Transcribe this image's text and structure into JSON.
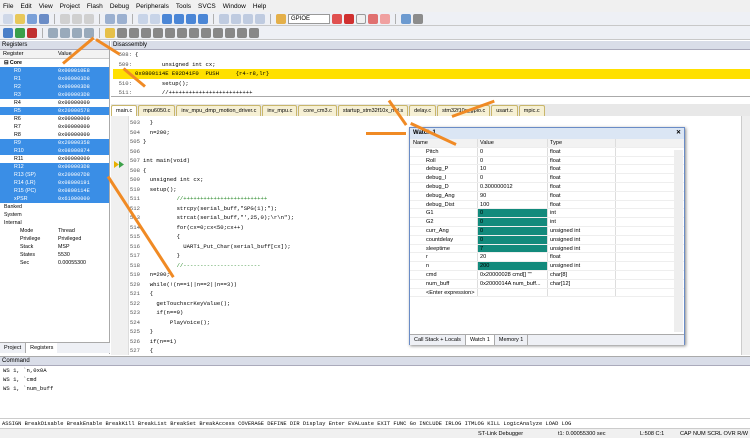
{
  "menu": [
    "File",
    "Edit",
    "View",
    "Project",
    "Flash",
    "Debug",
    "Peripherals",
    "Tools",
    "SVCS",
    "Window",
    "Help"
  ],
  "toolbar": {
    "target_combo": "GPIOE"
  },
  "registers": {
    "title": "Registers",
    "col_register": "Register",
    "col_value": "Value",
    "group_core": "Core",
    "rows": [
      {
        "n": "R0",
        "v": "0x000010E8",
        "h": true
      },
      {
        "n": "R1",
        "v": "0x000003D8",
        "h": true
      },
      {
        "n": "R2",
        "v": "0x000003D8",
        "h": true
      },
      {
        "n": "R3",
        "v": "0x000003D8",
        "h": true
      },
      {
        "n": "R4",
        "v": "0x00000000",
        "h": false
      },
      {
        "n": "R5",
        "v": "0x20000578",
        "h": true
      },
      {
        "n": "R6",
        "v": "0x00000000",
        "h": false
      },
      {
        "n": "R7",
        "v": "0x00000000",
        "h": false
      },
      {
        "n": "R8",
        "v": "0x00000000",
        "h": false
      },
      {
        "n": "R9",
        "v": "0x20000358",
        "h": true
      },
      {
        "n": "R10",
        "v": "0x08000874",
        "h": true
      },
      {
        "n": "R11",
        "v": "0x00000000",
        "h": false
      },
      {
        "n": "R12",
        "v": "0x000003D8",
        "h": true
      },
      {
        "n": "R13 (SP)",
        "v": "0x200007D8",
        "h": true
      },
      {
        "n": "R14 (LR)",
        "v": "0x08000191",
        "h": true
      },
      {
        "n": "R15 (PC)",
        "v": "0x0800114E",
        "h": true
      },
      {
        "n": "xPSR",
        "v": "0x61000000",
        "h": true
      }
    ],
    "groups": [
      "Banked",
      "System",
      "Internal"
    ],
    "internal": [
      {
        "n": "Mode",
        "v": "Thread"
      },
      {
        "n": "Privilege",
        "v": "Privileged"
      },
      {
        "n": "Stack",
        "v": "MSP"
      },
      {
        "n": "States",
        "v": "5530"
      },
      {
        "n": "Sec",
        "v": "0.00055300"
      }
    ],
    "tab_project": "Project",
    "tab_registers": "Registers"
  },
  "disassembly": {
    "title": "Disassembly",
    "lines": [
      {
        "ln": "508:",
        "t": "{"
      },
      {
        "ln": "509:",
        "t": "        unsigned int cx;"
      },
      {
        "ln": "",
        "t": "0x0800114E E92D41F0  PUSH     {r4-r8,lr}",
        "cur": true
      },
      {
        "ln": "510:",
        "t": "        setup();"
      },
      {
        "ln": "511:",
        "t": "        //+++++++++++++++++++++++++"
      }
    ]
  },
  "editor": {
    "tabs": [
      "main.c",
      "mpu6050.c",
      "inv_mpu_dmp_motion_driver.c",
      "inv_mpu.c",
      "core_cm3.c",
      "startup_stm32f10x_md.s",
      "delay.c",
      "stm32f10x_gpio.c",
      "usart.c",
      "mpic.c"
    ],
    "lines": [
      {
        "ln": "503",
        "t": "  }"
      },
      {
        "ln": "504",
        "t": "  n=200;"
      },
      {
        "ln": "505",
        "t": "}"
      },
      {
        "ln": "506",
        "t": ""
      },
      {
        "ln": "507",
        "t": "int main(void)"
      },
      {
        "ln": "508",
        "t": "{"
      },
      {
        "ln": "509",
        "t": "  unsigned int cx;"
      },
      {
        "ln": "510",
        "t": "  setup();"
      },
      {
        "ln": "511",
        "t": "          //+++++++++++++++++++++++++"
      },
      {
        "ln": "512",
        "t": "          strcpy(serial_buff,\"SPG(1);\");"
      },
      {
        "ln": "513",
        "t": "          strcat(serial_buff,\"',25,0);\\r\\n\");"
      },
      {
        "ln": "514",
        "t": "          for(cx=0;cx<50;cx++)"
      },
      {
        "ln": "515",
        "t": "          {"
      },
      {
        "ln": "516",
        "t": "            UART1_Put_Char(serial_buff[cx]);"
      },
      {
        "ln": "517",
        "t": "          }"
      },
      {
        "ln": "518",
        "t": "          //-----------------------"
      },
      {
        "ln": "519",
        "t": "  n=200;"
      },
      {
        "ln": "520",
        "t": "  while(!(n==1||n==2||n==3))"
      },
      {
        "ln": "521",
        "t": "  {"
      },
      {
        "ln": "522",
        "t": "    getTouchscrKeyValue();"
      },
      {
        "ln": "523",
        "t": "    if(n==9)"
      },
      {
        "ln": "524",
        "t": "        PlayVoice();"
      },
      {
        "ln": "525",
        "t": "  }"
      },
      {
        "ln": "526",
        "t": "  if(n==1)"
      },
      {
        "ln": "527",
        "t": "  {"
      },
      {
        "ln": "528",
        "t": "    n=200;"
      },
      {
        "ln": "529",
        "t": "    MODE=1;"
      }
    ]
  },
  "watch": {
    "title": "Watch 1",
    "col_name": "Name",
    "col_value": "Value",
    "col_type": "Type",
    "rows": [
      {
        "n": "Pitch",
        "v": "0",
        "t": "float",
        "teal": false
      },
      {
        "n": "Roll",
        "v": "0",
        "t": "float",
        "teal": false
      },
      {
        "n": "debug_P",
        "v": "10",
        "t": "float",
        "teal": false
      },
      {
        "n": "debug_I",
        "v": "0",
        "t": "float",
        "teal": false
      },
      {
        "n": "debug_D",
        "v": "0.300000012",
        "t": "float",
        "teal": false
      },
      {
        "n": "debug_Ang",
        "v": "90",
        "t": "float",
        "teal": false
      },
      {
        "n": "debug_Dist",
        "v": "100",
        "t": "float",
        "teal": false
      },
      {
        "n": "G1",
        "v": "0",
        "t": "int",
        "teal": true
      },
      {
        "n": "G2",
        "v": "0",
        "t": "int",
        "teal": true
      },
      {
        "n": "curr_Ang",
        "v": "0",
        "t": "unsigned int",
        "teal": true
      },
      {
        "n": "countdelay",
        "v": "0",
        "t": "unsigned int",
        "teal": true
      },
      {
        "n": "sleeptime",
        "v": "7",
        "t": "unsigned int",
        "teal": true
      },
      {
        "n": "r",
        "v": "20",
        "t": "float",
        "teal": false
      },
      {
        "n": "n",
        "v": "200",
        "t": "unsigned int",
        "teal": true
      },
      {
        "n": "cmd",
        "v": "0x20000028 cmd[] \"\"",
        "t": "char[8]",
        "teal": false
      },
      {
        "n": "num_buff",
        "v": "0x2000014A num_buff...",
        "t": "char[12]",
        "teal": false
      },
      {
        "n": "<Enter expression>",
        "v": "",
        "t": "",
        "teal": false
      }
    ],
    "tabs": [
      "Call Stack + Locals",
      "Watch 1",
      "Memory 1"
    ]
  },
  "command": {
    "title": "Command",
    "lines": [
      "WS 1, `n,0x0A",
      "WS 1, `cmd",
      "WS 1, `num_buff"
    ],
    "hint": "ASSIGN BreakDisable BreakEnable BreakKill BreakList BreakSet BreakAccess COVERAGE DEFINE DIR Display Enter EVALuate EXIT FUNC Go INCLUDE IRLOG ITMLOG KILL LogicAnalyze LOAD LOG"
  },
  "status": {
    "debugger": "ST-Link Debugger",
    "time": "t1: 0.00055300 sec",
    "pos": "L:508 C:1",
    "caps": "CAP NUM SCRL OVR R/W"
  }
}
